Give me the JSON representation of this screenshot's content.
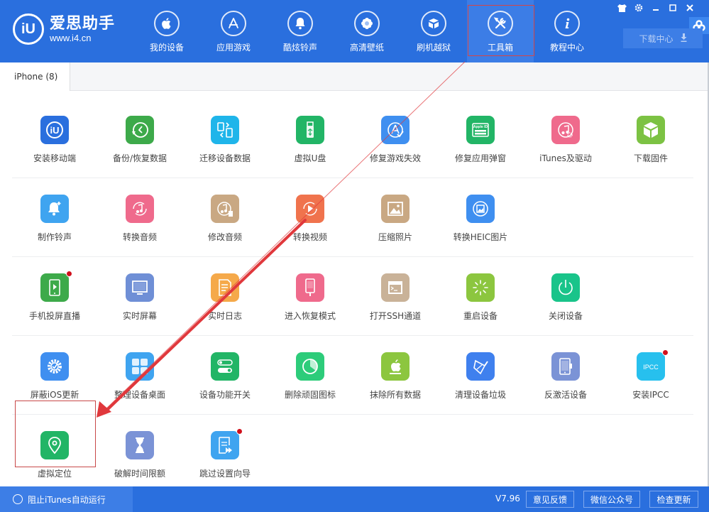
{
  "app": {
    "logo_mark": "iU",
    "name": "爱思助手",
    "url": "www.i4.cn"
  },
  "nav": [
    {
      "label": "我的设备",
      "icon": "apple-icon"
    },
    {
      "label": "应用游戏",
      "icon": "app-store-icon"
    },
    {
      "label": "酷炫铃声",
      "icon": "bell-icon"
    },
    {
      "label": "高清壁纸",
      "icon": "flower-icon"
    },
    {
      "label": "刷机越狱",
      "icon": "box-icon"
    },
    {
      "label": "工具箱",
      "icon": "tools-icon",
      "active": true
    },
    {
      "label": "教程中心",
      "icon": "info-icon"
    }
  ],
  "window_controls": [
    "skin-icon",
    "settings-icon",
    "minimize-icon",
    "maximize-icon",
    "close-icon"
  ],
  "download_center": {
    "label": "下载中心"
  },
  "tabs": [
    {
      "label": "iPhone (8)",
      "active": true
    }
  ],
  "tools": [
    [
      {
        "label": "安装移动端",
        "icon": "i4-logo-icon",
        "color": "#2a6fde"
      },
      {
        "label": "备份/恢复数据",
        "icon": "backup-restore-icon",
        "color": "#3daa4a"
      },
      {
        "label": "迁移设备数据",
        "icon": "migrate-data-icon",
        "color": "#1fb5ea"
      },
      {
        "label": "虚拟U盘",
        "icon": "usb-drive-icon",
        "color": "#22b566"
      },
      {
        "label": "修复游戏失效",
        "icon": "fix-game-icon",
        "color": "#3f8ff0"
      },
      {
        "label": "修复应用弹窗",
        "icon": "apple-id-icon",
        "color": "#22b566",
        "icon_text": "Apple ID"
      },
      {
        "label": "iTunes及驱动",
        "icon": "itunes-driver-icon",
        "color": "#ef6a8c"
      },
      {
        "label": "下载固件",
        "icon": "firmware-box-icon",
        "color": "#7cc243"
      }
    ],
    [
      {
        "label": "制作铃声",
        "icon": "make-ringtone-icon",
        "color": "#3fa4f0"
      },
      {
        "label": "转换音频",
        "icon": "convert-audio-icon",
        "color": "#ef6a8c"
      },
      {
        "label": "修改音频",
        "icon": "edit-audio-icon",
        "color": "#c9a883"
      },
      {
        "label": "转换视频",
        "icon": "convert-video-icon",
        "color": "#f0734d"
      },
      {
        "label": "压缩照片",
        "icon": "compress-photo-icon",
        "color": "#c9a883"
      },
      {
        "label": "转换HEIC图片",
        "icon": "convert-heic-icon",
        "color": "#3f8ff0"
      }
    ],
    [
      {
        "label": "手机投屏直播",
        "icon": "screen-mirror-icon",
        "color": "#3daa4a",
        "badge": true
      },
      {
        "label": "实时屏幕",
        "icon": "realtime-screen-icon",
        "color": "#6f8fd6"
      },
      {
        "label": "实时日志",
        "icon": "realtime-log-icon",
        "color": "#f5a94a"
      },
      {
        "label": "进入恢复模式",
        "icon": "recovery-mode-icon",
        "color": "#ef6a8c"
      },
      {
        "label": "打开SSH通道",
        "icon": "ssh-terminal-icon",
        "color": "#c9b298"
      },
      {
        "label": "重启设备",
        "icon": "restart-icon",
        "color": "#8cc63f"
      },
      {
        "label": "关闭设备",
        "icon": "power-icon",
        "color": "#19c48a"
      }
    ],
    [
      {
        "label": "屏蔽iOS更新",
        "icon": "block-update-icon",
        "color": "#3f8ff0"
      },
      {
        "label": "整理设备桌面",
        "icon": "organize-desktop-icon",
        "color": "#3fa4f0"
      },
      {
        "label": "设备功能开关",
        "icon": "toggle-switch-icon",
        "color": "#22b566"
      },
      {
        "label": "删除顽固图标",
        "icon": "delete-icon-pie-icon",
        "color": "#2dcc7a"
      },
      {
        "label": "抹除所有数据",
        "icon": "erase-data-icon",
        "color": "#8cc63f"
      },
      {
        "label": "清理设备垃圾",
        "icon": "clean-broom-icon",
        "color": "#3f80ee"
      },
      {
        "label": "反激活设备",
        "icon": "deactivate-icon",
        "color": "#7b93d6"
      },
      {
        "label": "安装IPCC",
        "icon": "ipcc-icon",
        "color": "#27c0ee",
        "icon_text": "IPCC",
        "badge": true
      }
    ],
    [
      {
        "label": "虚拟定位",
        "icon": "location-pin-icon",
        "color": "#22b566",
        "highlighted": true
      },
      {
        "label": "破解时间限额",
        "icon": "hourglass-icon",
        "color": "#7b93d6"
      },
      {
        "label": "跳过设置向导",
        "icon": "skip-setup-icon",
        "color": "#3fa4f0",
        "badge": true
      }
    ]
  ],
  "footer": {
    "itunes_toggle": "阻止iTunes自动运行",
    "version": "V7.96",
    "buttons": [
      "意见反馈",
      "微信公众号",
      "检查更新"
    ]
  },
  "annotation": {
    "color": "#e0383c"
  }
}
